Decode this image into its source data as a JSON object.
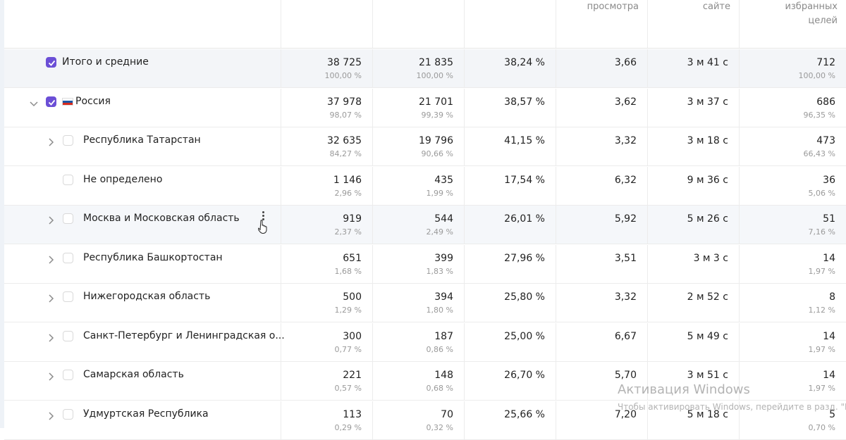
{
  "header": {
    "columns": [
      "",
      "",
      "",
      "просмотра",
      "сайте",
      "избранных\nцелей"
    ]
  },
  "rows": [
    {
      "name": "Итого и средние",
      "expander": "none",
      "checked": true,
      "flag": false,
      "type": "total",
      "visits": "38 725",
      "visits_pct": "100,00 %",
      "users": "21 835",
      "users_pct": "100,00 %",
      "bounce": "38,24 %",
      "depth": "3,66",
      "time": "3 м 41 с",
      "goals": "712",
      "goals_pct": "100,00 %"
    },
    {
      "name": "Россия",
      "expander": "expanded",
      "checked": true,
      "flag": true,
      "type": "country",
      "visits": "37 978",
      "visits_pct": "98,07 %",
      "users": "21 701",
      "users_pct": "99,39 %",
      "bounce": "38,57 %",
      "depth": "3,62",
      "time": "3 м 37 с",
      "goals": "686",
      "goals_pct": "96,35 %"
    },
    {
      "name": "Республика Татарстан",
      "expander": "collapsed",
      "checked": false,
      "flag": false,
      "type": "region",
      "visits": "32 635",
      "visits_pct": "84,27 %",
      "users": "19 796",
      "users_pct": "90,66 %",
      "bounce": "41,15 %",
      "depth": "3,32",
      "time": "3 м 18 с",
      "goals": "473",
      "goals_pct": "66,43 %"
    },
    {
      "name": "Не определено",
      "expander": "none",
      "checked": false,
      "flag": false,
      "type": "region",
      "visits": "1 146",
      "visits_pct": "2,96 %",
      "users": "435",
      "users_pct": "1,99 %",
      "bounce": "17,54 %",
      "depth": "6,32",
      "time": "9 м 36 с",
      "goals": "36",
      "goals_pct": "5,06 %"
    },
    {
      "name": "Москва и Московская область",
      "expander": "collapsed",
      "checked": false,
      "flag": false,
      "type": "region",
      "hover": true,
      "visits": "919",
      "visits_pct": "2,37 %",
      "users": "544",
      "users_pct": "2,49 %",
      "bounce": "26,01 %",
      "depth": "5,92",
      "time": "5 м 26 с",
      "goals": "51",
      "goals_pct": "7,16 %"
    },
    {
      "name": "Республика Башкортостан",
      "expander": "collapsed",
      "checked": false,
      "flag": false,
      "type": "region",
      "visits": "651",
      "visits_pct": "1,68 %",
      "users": "399",
      "users_pct": "1,83 %",
      "bounce": "27,96 %",
      "depth": "3,51",
      "time": "3 м 3 с",
      "goals": "14",
      "goals_pct": "1,97 %"
    },
    {
      "name": "Нижегородская область",
      "expander": "collapsed",
      "checked": false,
      "flag": false,
      "type": "region",
      "visits": "500",
      "visits_pct": "1,29 %",
      "users": "394",
      "users_pct": "1,80 %",
      "bounce": "25,80 %",
      "depth": "3,32",
      "time": "2 м 52 с",
      "goals": "8",
      "goals_pct": "1,12 %"
    },
    {
      "name": "Санкт-Петербург и Ленинградская о...",
      "expander": "collapsed",
      "checked": false,
      "flag": false,
      "type": "region",
      "visits": "300",
      "visits_pct": "0,77 %",
      "users": "187",
      "users_pct": "0,86 %",
      "bounce": "25,00 %",
      "depth": "6,67",
      "time": "5 м 49 с",
      "goals": "14",
      "goals_pct": "1,97 %"
    },
    {
      "name": "Самарская область",
      "expander": "collapsed",
      "checked": false,
      "flag": false,
      "type": "region",
      "visits": "221",
      "visits_pct": "0,57 %",
      "users": "148",
      "users_pct": "0,68 %",
      "bounce": "26,70 %",
      "depth": "5,70",
      "time": "3 м 51 с",
      "goals": "14",
      "goals_pct": "1,97 %"
    },
    {
      "name": "Удмуртская Республика",
      "expander": "collapsed",
      "checked": false,
      "flag": false,
      "type": "region",
      "visits": "113",
      "visits_pct": "0,29 %",
      "users": "70",
      "users_pct": "0,32 %",
      "bounce": "25,66 %",
      "depth": "7,20",
      "time": "5 м 18 с",
      "goals": "5",
      "goals_pct": "0,70 %"
    }
  ],
  "watermark": {
    "title": "Активация Windows",
    "text": "Чтобы активировать Windows, перейдите в разд. \"Параметры\"."
  },
  "colors": {
    "accent": "#6b4fd6",
    "flag_white": "#ffffff",
    "flag_blue": "#1c57a5",
    "flag_red": "#d52b1e"
  }
}
